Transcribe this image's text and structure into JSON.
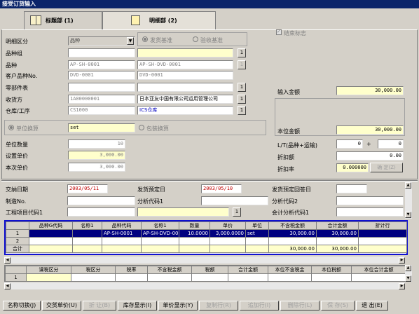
{
  "window": {
    "title": "接受订货输入"
  },
  "tabs": [
    {
      "label": "标题部 (1)"
    },
    {
      "label": "明细部 (2)"
    }
  ],
  "detail": {
    "category_label": "明细区分",
    "category_value": "品种",
    "radio_ship": "发货基准",
    "radio_accept": "验收基准",
    "end_flag": "结束标志",
    "item_group_label": "品种组",
    "item_label": "品种",
    "item_code": "AP-SH-0001",
    "item_name": "AP-SH-DVD-0001",
    "cust_item_label": "客户品种No.",
    "cust_item_code": "DVD-0001",
    "cust_item_name": "DVD-0001",
    "parts_label": "零部件表",
    "receiver_label": "收货方",
    "receiver_code": "1A00000001",
    "receiver_name": "日本亚友中国有限公司运用管理公司",
    "warehouse_label": "仓库/工序",
    "warehouse_code": "CS1000",
    "warehouse_name": "ICS仓库",
    "unit_conv": "单位换算",
    "unit_value": "set",
    "pack_conv": "包装换算",
    "qty_label": "单位数量",
    "qty_value": "10",
    "unit_price_label": "设置单价",
    "unit_price_value": "3,000.00",
    "this_price_label": "本次单价",
    "this_price_value": "3,000.00",
    "input_amount_label": "输入金额",
    "input_amount_value": "30,000.00",
    "base_amount_label": "本位金额",
    "base_amount_value": "30,000.00",
    "lt_label": "L/T(品种+运输)",
    "lt_value1": "0",
    "lt_value2": "0",
    "discount_label": "折扣额",
    "discount_value": "0.00",
    "discount_rate_label": "折扣率",
    "discount_rate_value": "0.000000",
    "confirm_btn": "确 定(Z)",
    "delivery_date_label": "交纳日期",
    "delivery_date_value": "2003/05/11",
    "ship_date_label": "发货预定日",
    "ship_date_value": "2003/05/10",
    "ship_reply_label": "发货预定回答日",
    "make_no_label": "制造No.",
    "analysis1_label": "分析代码1",
    "analysis2_label": "分析代码2",
    "project1_label": "工程项目代码1",
    "acct_analysis1_label": "会计分析代码1"
  },
  "grid1": {
    "headers": [
      "",
      "品种G代码",
      "名称1",
      "品种代码",
      "名称1",
      "数量",
      "单价",
      "单位",
      "不含税金额",
      "合计金额",
      "折计行"
    ],
    "rows": [
      [
        "1",
        "",
        "",
        "AP-SH-0001",
        "AP-SH-DVD-000",
        "10.0000",
        "3,000.0000",
        "set",
        "30,000.00",
        "30,000.00",
        ""
      ],
      [
        "2",
        "",
        "",
        "",
        "",
        "",
        "",
        "",
        "",
        "",
        ""
      ],
      [
        "合计",
        "",
        "",
        "",
        "",
        "",
        "",
        "",
        "30,000.00",
        "30,000.00",
        ""
      ]
    ]
  },
  "grid2": {
    "headers": [
      "",
      "课税区分",
      "税区分",
      "税率",
      "不含税金额",
      "税额",
      "合计金额",
      "本位不含税金",
      "本位税额",
      "本位合计金额"
    ],
    "rows": [
      [
        "1",
        "",
        "",
        "",
        "",
        "",
        "",
        "",
        "",
        ""
      ]
    ]
  },
  "buttons": [
    {
      "label": "名称切换(J)",
      "enabled": true
    },
    {
      "label": "交货单价(U)",
      "enabled": true
    },
    {
      "label": "折 让(B)",
      "enabled": false
    },
    {
      "label": "库存显示(I)",
      "enabled": true
    },
    {
      "label": "单价显示(Y)",
      "enabled": true
    },
    {
      "label": "复制行(R)",
      "enabled": false
    },
    {
      "label": "追加行(I)",
      "enabled": false
    },
    {
      "label": "删除行(L)",
      "enabled": false
    },
    {
      "label": "保 存(S)",
      "enabled": false
    },
    {
      "label": "退 出(E)",
      "enabled": true
    }
  ]
}
